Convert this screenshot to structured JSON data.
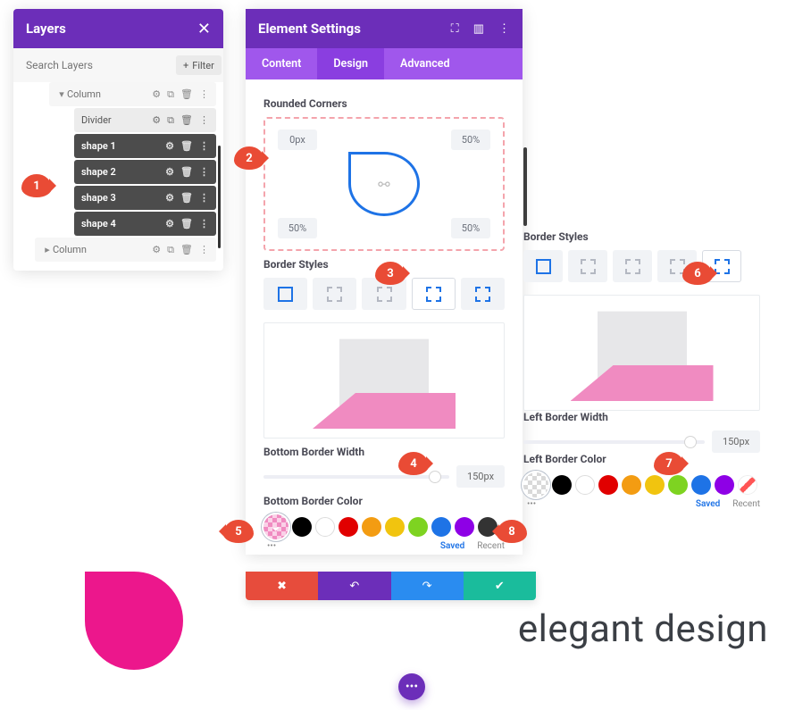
{
  "layers": {
    "title": "Layers",
    "search_placeholder": "Search Layers",
    "filter_label": "Filter",
    "items": [
      {
        "label": "Column",
        "type": "light",
        "indent": 1,
        "caret": true
      },
      {
        "label": "Divider",
        "type": "white",
        "indent": 2
      },
      {
        "label": "shape 1",
        "type": "dark",
        "indent": 2
      },
      {
        "label": "shape 2",
        "type": "dark",
        "indent": 2
      },
      {
        "label": "shape 3",
        "type": "dark",
        "indent": 2
      },
      {
        "label": "shape 4",
        "type": "dark",
        "indent": 2
      },
      {
        "label": "Column",
        "type": "light",
        "indent": 0,
        "caret": true
      }
    ]
  },
  "settings": {
    "title": "Element Settings",
    "tabs": {
      "content": "Content",
      "design": "Design",
      "advanced": "Advanced"
    },
    "rounded": {
      "title": "Rounded Corners",
      "tl": "0px",
      "tr": "50%",
      "bl": "50%",
      "br": "50%"
    },
    "border_styles_title": "Border Styles",
    "bottom_width": {
      "title": "Bottom Border Width",
      "value": "150px"
    },
    "bottom_color_title": "Bottom Border Color",
    "left_width": {
      "title": "Left Border Width",
      "value": "150px"
    },
    "left_color_title": "Left Border Color",
    "sub_saved": "Saved",
    "sub_recent": "Recent",
    "palette": [
      "#000000",
      "#ffffff",
      "#e10000",
      "#f39c12",
      "#f1c40f",
      "#7ed321",
      "#1e73e6",
      "#8e00e6",
      "#333333"
    ]
  },
  "footer": {
    "elegant": "elegant design"
  },
  "callouts": [
    "1",
    "2",
    "3",
    "4",
    "5",
    "6",
    "7",
    "8"
  ]
}
